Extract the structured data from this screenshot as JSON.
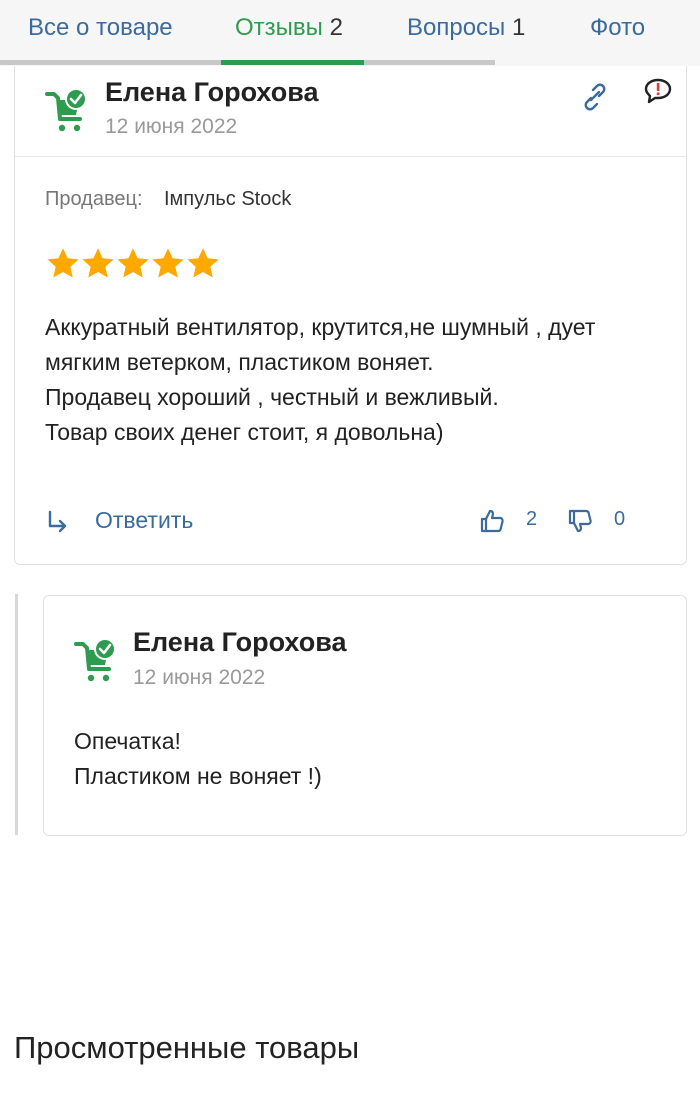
{
  "tabs": [
    {
      "label": "Все о товаре",
      "count": ""
    },
    {
      "label": "Отзывы",
      "count": "2"
    },
    {
      "label": "Вопросы",
      "count": "1"
    },
    {
      "label": "Фото",
      "count": ""
    }
  ],
  "active_tab": "Отзывы",
  "review": {
    "author": "Елена Горохова",
    "date": "12 июня 2022",
    "seller_label": "Продавец:",
    "seller_name": "Імпульс Stock",
    "rating": 5,
    "rating_max": 5,
    "text_lines": [
      "Аккуратный вентилятор, крутится,не шумный , дует",
      "мягким ветерком, пластиком воняет.",
      "Продавец хороший , честный и вежливый.",
      "Товар своих денег стоит, я довольна)"
    ],
    "reply_label": "Ответить",
    "likes": "2",
    "dislikes": "0",
    "icons": {
      "avatar": "green-cart-check-icon",
      "link": "link-icon",
      "report": "report-speech-icon",
      "reply": "reply-arrow-icon",
      "like": "thumbs-up-icon",
      "dislike": "thumbs-down-icon"
    }
  },
  "reply": {
    "author": "Елена Горохова",
    "date": "12 июня 2022",
    "text_lines": [
      "Опечатка!",
      "Пластиком не воняет !)"
    ]
  },
  "viewed_products": {
    "title": "Просмотренные товары"
  },
  "colors": {
    "accent_green": "#2e9c4f",
    "link_blue": "#3b6b9c",
    "star": "#ffa800",
    "report_red": "#e53935"
  }
}
